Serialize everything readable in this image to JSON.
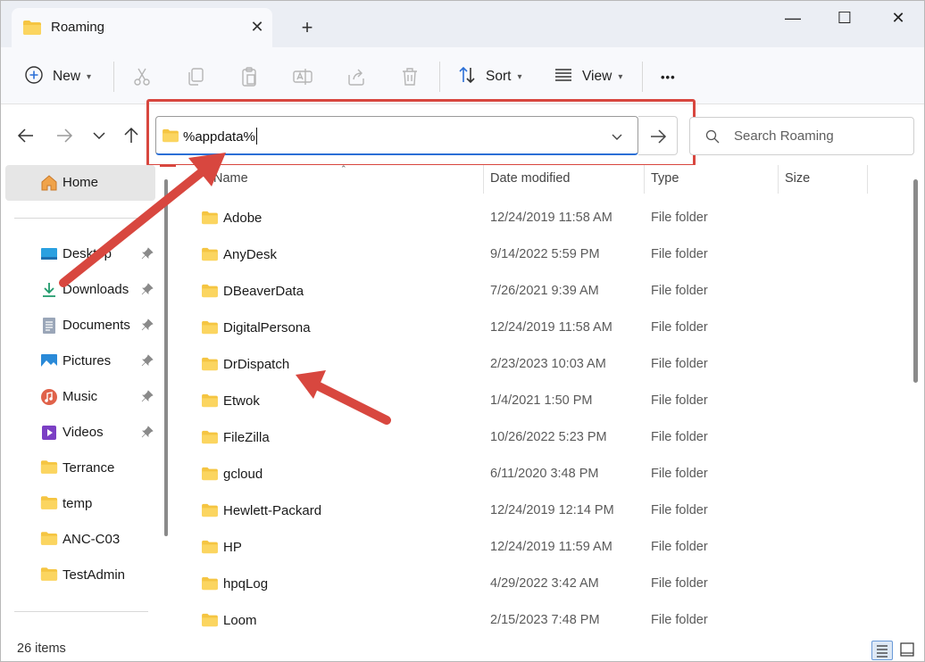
{
  "window": {
    "tab_title": "Roaming",
    "new_tab_symbol": "+",
    "close_tab_symbol": "✕",
    "minimize_symbol": "—",
    "maximize_symbol": "☐",
    "close_symbol": "✕"
  },
  "toolbar": {
    "new_label": "New",
    "sort_label": "Sort",
    "view_label": "View",
    "more_symbol": "•••",
    "icons": [
      "plus-circle-icon",
      "cut-icon",
      "copy-icon",
      "paste-icon",
      "rename-icon",
      "share-icon",
      "delete-icon",
      "sort-icon",
      "view-icon"
    ]
  },
  "address": {
    "value": "%appdata%",
    "search_placeholder": "Search Roaming"
  },
  "sidebar": {
    "home_label": "Home",
    "items": [
      {
        "label": "Desktop",
        "icon": "desktop-icon",
        "pinned": true
      },
      {
        "label": "Downloads",
        "icon": "downloads-icon",
        "pinned": true
      },
      {
        "label": "Documents",
        "icon": "documents-icon",
        "pinned": true
      },
      {
        "label": "Pictures",
        "icon": "pictures-icon",
        "pinned": true
      },
      {
        "label": "Music",
        "icon": "music-icon",
        "pinned": true
      },
      {
        "label": "Videos",
        "icon": "videos-icon",
        "pinned": true
      },
      {
        "label": "Terrance",
        "icon": "folder-icon",
        "pinned": false
      },
      {
        "label": "temp",
        "icon": "folder-icon",
        "pinned": false
      },
      {
        "label": "ANC-C03",
        "icon": "folder-icon",
        "pinned": false
      },
      {
        "label": "TestAdmin",
        "icon": "folder-icon",
        "pinned": false
      }
    ]
  },
  "columns": {
    "name": "Name",
    "date_modified": "Date modified",
    "type": "Type",
    "size": "Size"
  },
  "rows": [
    {
      "name": "Adobe",
      "date": "12/24/2019 11:58 AM",
      "type": "File folder",
      "size": ""
    },
    {
      "name": "AnyDesk",
      "date": "9/14/2022 5:59 PM",
      "type": "File folder",
      "size": ""
    },
    {
      "name": "DBeaverData",
      "date": "7/26/2021 9:39 AM",
      "type": "File folder",
      "size": ""
    },
    {
      "name": "DigitalPersona",
      "date": "12/24/2019 11:58 AM",
      "type": "File folder",
      "size": ""
    },
    {
      "name": "DrDispatch",
      "date": "2/23/2023 10:03 AM",
      "type": "File folder",
      "size": ""
    },
    {
      "name": "Etwok",
      "date": "1/4/2021 1:50 PM",
      "type": "File folder",
      "size": ""
    },
    {
      "name": "FileZilla",
      "date": "10/26/2022 5:23 PM",
      "type": "File folder",
      "size": ""
    },
    {
      "name": "gcloud",
      "date": "6/11/2020 3:48 PM",
      "type": "File folder",
      "size": ""
    },
    {
      "name": "Hewlett-Packard",
      "date": "12/24/2019 12:14 PM",
      "type": "File folder",
      "size": ""
    },
    {
      "name": "HP",
      "date": "12/24/2019 11:59 AM",
      "type": "File folder",
      "size": ""
    },
    {
      "name": "hpqLog",
      "date": "4/29/2022 3:42 AM",
      "type": "File folder",
      "size": ""
    },
    {
      "name": "Loom",
      "date": "2/15/2023 7:48 PM",
      "type": "File folder",
      "size": ""
    }
  ],
  "status": {
    "item_count": "26 items"
  },
  "colors": {
    "annotation_red": "#d8473f",
    "folder_yellow": "#f5c542",
    "accent_blue": "#2b6fd6"
  }
}
